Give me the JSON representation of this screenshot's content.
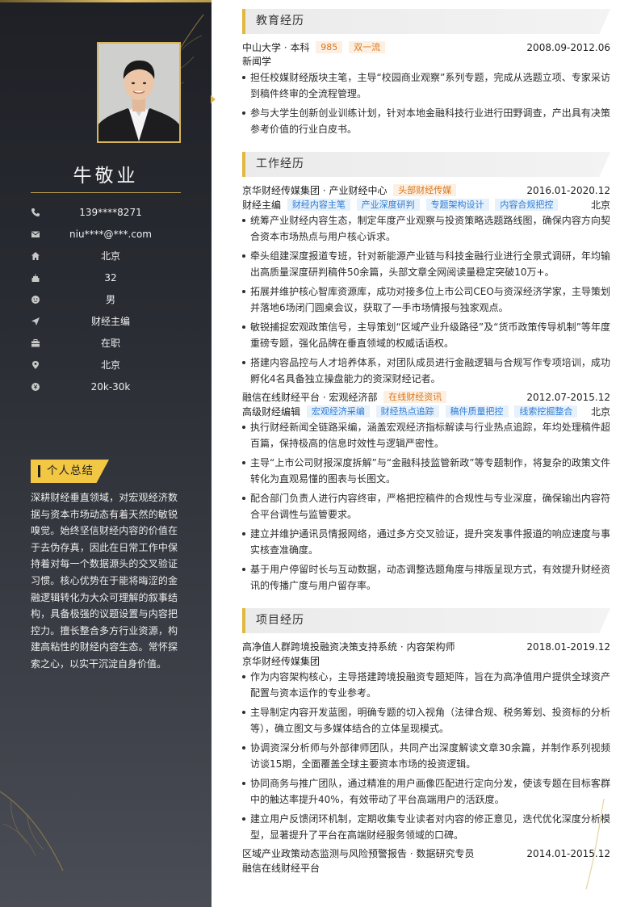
{
  "profile": {
    "name": "牛敬业",
    "info": [
      {
        "icon": "phone-icon",
        "value": "139****8271"
      },
      {
        "icon": "mail-icon",
        "value": "niu****@***.com"
      },
      {
        "icon": "home-icon",
        "value": "北京"
      },
      {
        "icon": "cake-icon",
        "value": "32"
      },
      {
        "icon": "gender-icon",
        "value": "男"
      },
      {
        "icon": "send-icon",
        "value": "财经主编"
      },
      {
        "icon": "briefcase-icon",
        "value": "在职"
      },
      {
        "icon": "location-pin-icon",
        "value": "北京"
      },
      {
        "icon": "salary-icon",
        "value": "20k-30k"
      }
    ],
    "summary_title": "个人总结",
    "summary": "深耕财经垂直领域，对宏观经济数据与资本市场动态有着天然的敏锐嗅觉。始终坚信财经内容的价值在于去伪存真，因此在日常工作中保持着对每一个数据源头的交叉验证习惯。核心优势在于能将晦涩的金融逻辑转化为大众可理解的叙事结构，具备极强的议题设置与内容把控力。擅长整合多方行业资源，构建高粘性的财经内容生态。常怀探索之心，以实干沉淀自身价值。"
  },
  "education": {
    "title": "教育经历",
    "school": "中山大学 · 本科",
    "tags": [
      "985",
      "双一流"
    ],
    "period": "2008.09-2012.06",
    "major": "新闻学",
    "bullets": [
      "担任校媒财经版块主笔，主导“校园商业观察”系列专题，完成从选题立项、专家采访到稿件终审的全流程管理。",
      "参与大学生创新创业训练计划，针对本地金融科技行业进行田野调查，产出具有决策参考价值的行业白皮书。"
    ]
  },
  "work": {
    "title": "工作经历",
    "jobs": [
      {
        "company": "京华财经传媒集团 · 产业财经中心",
        "company_tag": "头部财经传媒",
        "period": "2016.01-2020.12",
        "role": "财经主编",
        "role_tags": [
          "财经内容主笔",
          "产业深度研判",
          "专题架构设计",
          "内容合规把控"
        ],
        "city": "北京",
        "bullets": [
          "统筹产业财经内容生态，制定年度产业观察与投资策略选题路线图，确保内容方向契合资本市场热点与用户核心诉求。",
          "牵头组建深度报道专班，针对新能源产业链与科技金融行业进行全景式调研，年均输出高质量深度研判稿件50余篇，头部文章全网阅读量稳定突破10万+。",
          "拓展并维护核心智库资源库，成功对接多位上市公司CEO与资深经济学家，主导策划并落地6场闭门圆桌会议，获取了一手市场情报与独家观点。",
          "敏锐捕捉宏观政策信号，主导策划“区域产业升级路径”及“货币政策传导机制”等年度重磅专题，强化品牌在垂直领域的权威话语权。",
          "搭建内容品控与人才培养体系，对团队成员进行金融逻辑与合规写作专项培训，成功孵化4名具备独立操盘能力的资深财经记者。"
        ]
      },
      {
        "company": "融信在线财经平台 · 宏观经济部",
        "company_tag": "在线财经资讯",
        "period": "2012.07-2015.12",
        "role": "高级财经编辑",
        "role_tags": [
          "宏观经济采编",
          "财经热点追踪",
          "稿件质量把控",
          "线索挖掘整合"
        ],
        "city": "北京",
        "bullets": [
          "执行财经新闻全链路采编，涵盖宏观经济指标解读与行业热点追踪，年均处理稿件超百篇，保持极高的信息时效性与逻辑严密性。",
          "主导“上市公司财报深度拆解”与“金融科技监管新政”等专题制作，将复杂的政策文件转化为直观易懂的图表与长图文。",
          "配合部门负责人进行内容终审，严格把控稿件的合规性与专业深度，确保输出内容符合平台调性与监管要求。",
          "建立并维护通讯员情报网络，通过多方交叉验证，提升突发事件报道的响应速度与事实核查准确度。",
          "基于用户停留时长与互动数据，动态调整选题角度与排版呈现方式，有效提升财经资讯的传播广度与用户留存率。"
        ]
      }
    ]
  },
  "projects": {
    "title": "项目经历",
    "items": [
      {
        "name": "高净值人群跨境投融资决策支持系统 · 内容架构师",
        "period": "2018.01-2019.12",
        "org": "京华财经传媒集团",
        "bullets": [
          "作为内容架构核心，主导搭建跨境投融资专题矩阵，旨在为高净值用户提供全球资产配置与资本运作的专业参考。",
          "主导制定内容开发蓝图，明确专题的切入视角（法律合规、税务筹划、投资标的分析等），确立图文与多媒体结合的立体呈现模式。",
          "协调资深分析师与外部律师团队，共同产出深度解读文章30余篇，并制作系列视频访谈15期，全面覆盖全球主要资本市场的投资逻辑。",
          "协同商务与推广团队，通过精准的用户画像匹配进行定向分发，使该专题在目标客群中的触达率提升40%，有效带动了平台高端用户的活跃度。",
          "建立用户反馈闭环机制，定期收集专业读者对内容的修正意见，迭代优化深度分析模型，显著提升了平台在高端财经服务领域的口碑。"
        ]
      },
      {
        "name": "区域产业政策动态监测与风险预警报告 · 数据研究专员",
        "period": "2014.01-2015.12",
        "org": "融信在线财经平台"
      }
    ]
  }
}
